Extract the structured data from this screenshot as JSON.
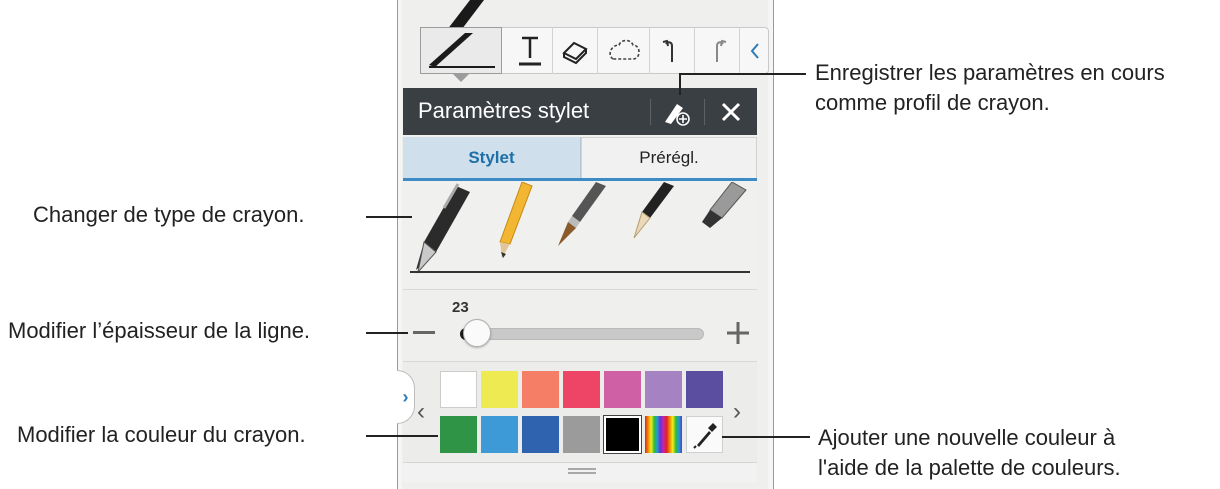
{
  "toolbar": {
    "tools": [
      {
        "name": "pen",
        "icon": "pen-icon",
        "active": true
      },
      {
        "name": "text",
        "icon": "text-icon"
      },
      {
        "name": "eraser",
        "icon": "eraser-icon"
      },
      {
        "name": "selection",
        "icon": "lasso-icon"
      },
      {
        "name": "undo",
        "icon": "undo-icon"
      },
      {
        "name": "redo",
        "icon": "redo-icon"
      },
      {
        "name": "collapse",
        "icon": "chevron-left-icon"
      }
    ]
  },
  "panel": {
    "title": "Paramètres stylet",
    "save_icon": "pen-plus-icon",
    "close_icon": "close-icon",
    "tabs": [
      {
        "label": "Stylet",
        "active": true
      },
      {
        "label": "Prérégl.",
        "active": false
      }
    ],
    "pen_types": [
      "fountain-pen",
      "pencil",
      "brush",
      "chinese-brush",
      "marker"
    ],
    "thickness": {
      "value": "23",
      "level": 0.05
    },
    "colors": {
      "row1": [
        "#ffffff",
        "#eeea52",
        "#f47f66",
        "#ee4466",
        "#d060a6",
        "#a583c3",
        "#5b4ea0"
      ],
      "row2": [
        "#2f9446",
        "#3d9ad6",
        "#2f63b0",
        "#9b9b9b",
        "#000000",
        "rainbow",
        "picker"
      ],
      "selected": "#000000"
    }
  },
  "annotations": {
    "save_profile": [
      "Enregistrer les paramètres en cours",
      "comme profil de crayon."
    ],
    "pen_type": "Changer de type de crayon.",
    "thickness": "Modifier l’épaisseur de la ligne.",
    "color": "Modifier la couleur du crayon.",
    "add_color": [
      "Ajouter une nouvelle couleur à",
      "l'aide de la palette de couleurs."
    ]
  }
}
